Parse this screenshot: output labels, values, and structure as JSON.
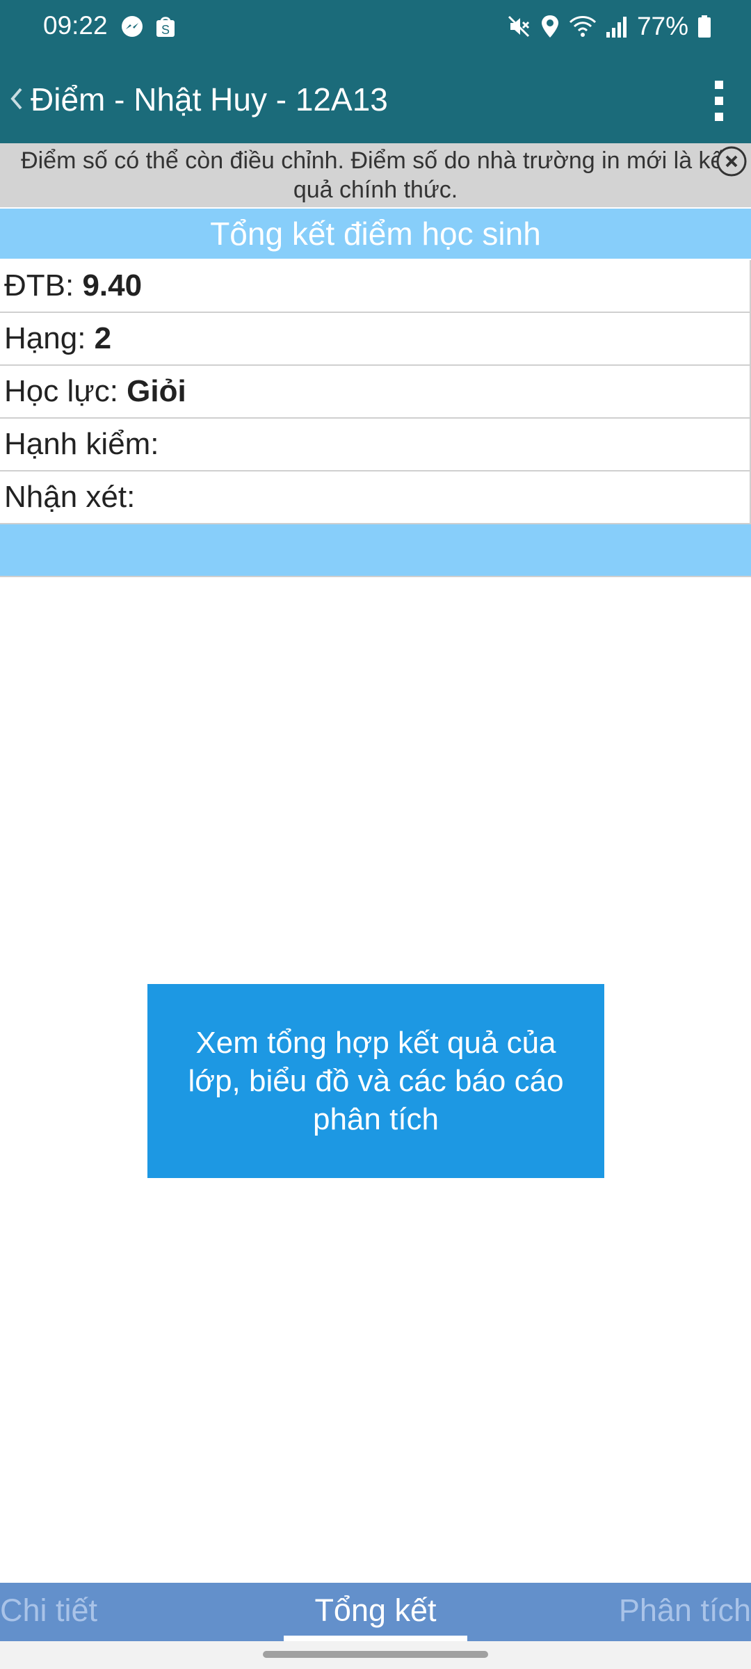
{
  "status_bar": {
    "time": "09:22",
    "battery": "77%",
    "icons": [
      "messenger-icon",
      "shopee-icon",
      "mute-icon",
      "location-icon",
      "wifi-icon",
      "signal-icon",
      "battery-icon"
    ]
  },
  "app_bar": {
    "title": "Điểm - Nhật Huy - 12A13",
    "back_icon": "chevron-left-icon",
    "menu_icon": "more-vert-icon"
  },
  "notice": {
    "text": "Điểm số có thể còn điều chỉnh. Điểm số do nhà trường in mới là kết quả chính thức.",
    "close_icon": "close-circle-icon"
  },
  "summary": {
    "header": "Tổng kết điểm học sinh",
    "rows": [
      {
        "label": "ĐTB: ",
        "value": "9.40"
      },
      {
        "label": "Hạng: ",
        "value": "2"
      },
      {
        "label": "Học lực: ",
        "value": "Giỏi"
      },
      {
        "label": "Hạnh kiểm: ",
        "value": ""
      },
      {
        "label": "Nhận xét: ",
        "value": ""
      }
    ]
  },
  "cta": {
    "label": "Xem tổng hợp kết quả của lớp, biểu đồ và các báo cáo phân tích"
  },
  "tabs": {
    "items": [
      "Chi tiết",
      "Tổng kết",
      "Phân tích"
    ],
    "active": "Tổng kết"
  },
  "colors": {
    "app_bar": "#1b6b7a",
    "header_blue": "#87cefa",
    "cta_blue": "#1d98e3",
    "tab_bar": "#6390cb",
    "notice_bg": "#d3d3d3"
  }
}
